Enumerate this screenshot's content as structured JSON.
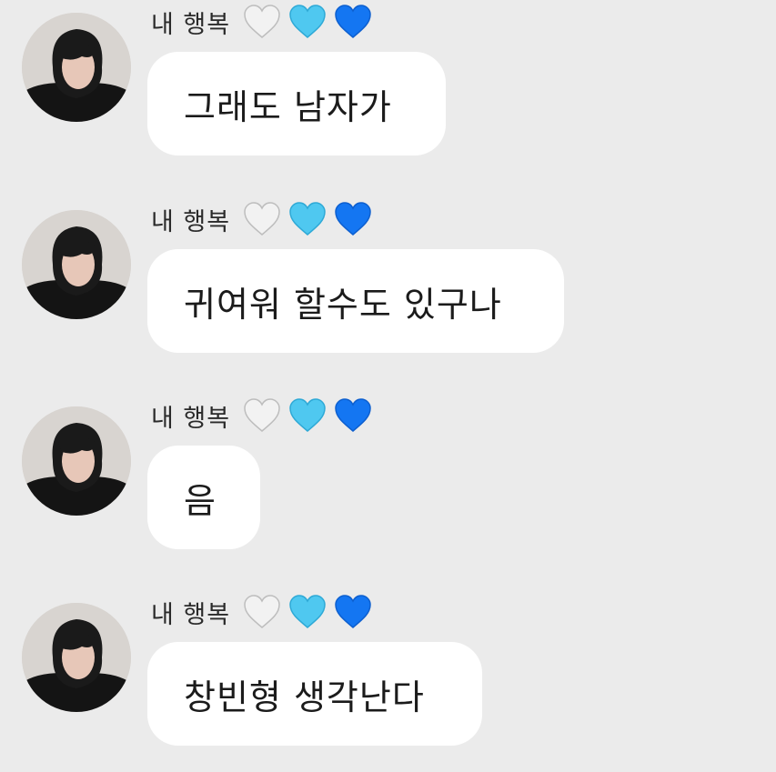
{
  "sender": {
    "name": "내 행복",
    "hearts": [
      {
        "icon": "white-heart-icon",
        "color": "#f2f2f2"
      },
      {
        "icon": "light-blue-heart-icon",
        "color": "#4fc8f0"
      },
      {
        "icon": "blue-heart-icon",
        "color": "#1476f2"
      }
    ]
  },
  "messages": [
    {
      "text": "그래도 남자가"
    },
    {
      "text": "귀여워 할수도 있구나"
    },
    {
      "text": "음"
    },
    {
      "text": "창빈형 생각난다"
    }
  ]
}
